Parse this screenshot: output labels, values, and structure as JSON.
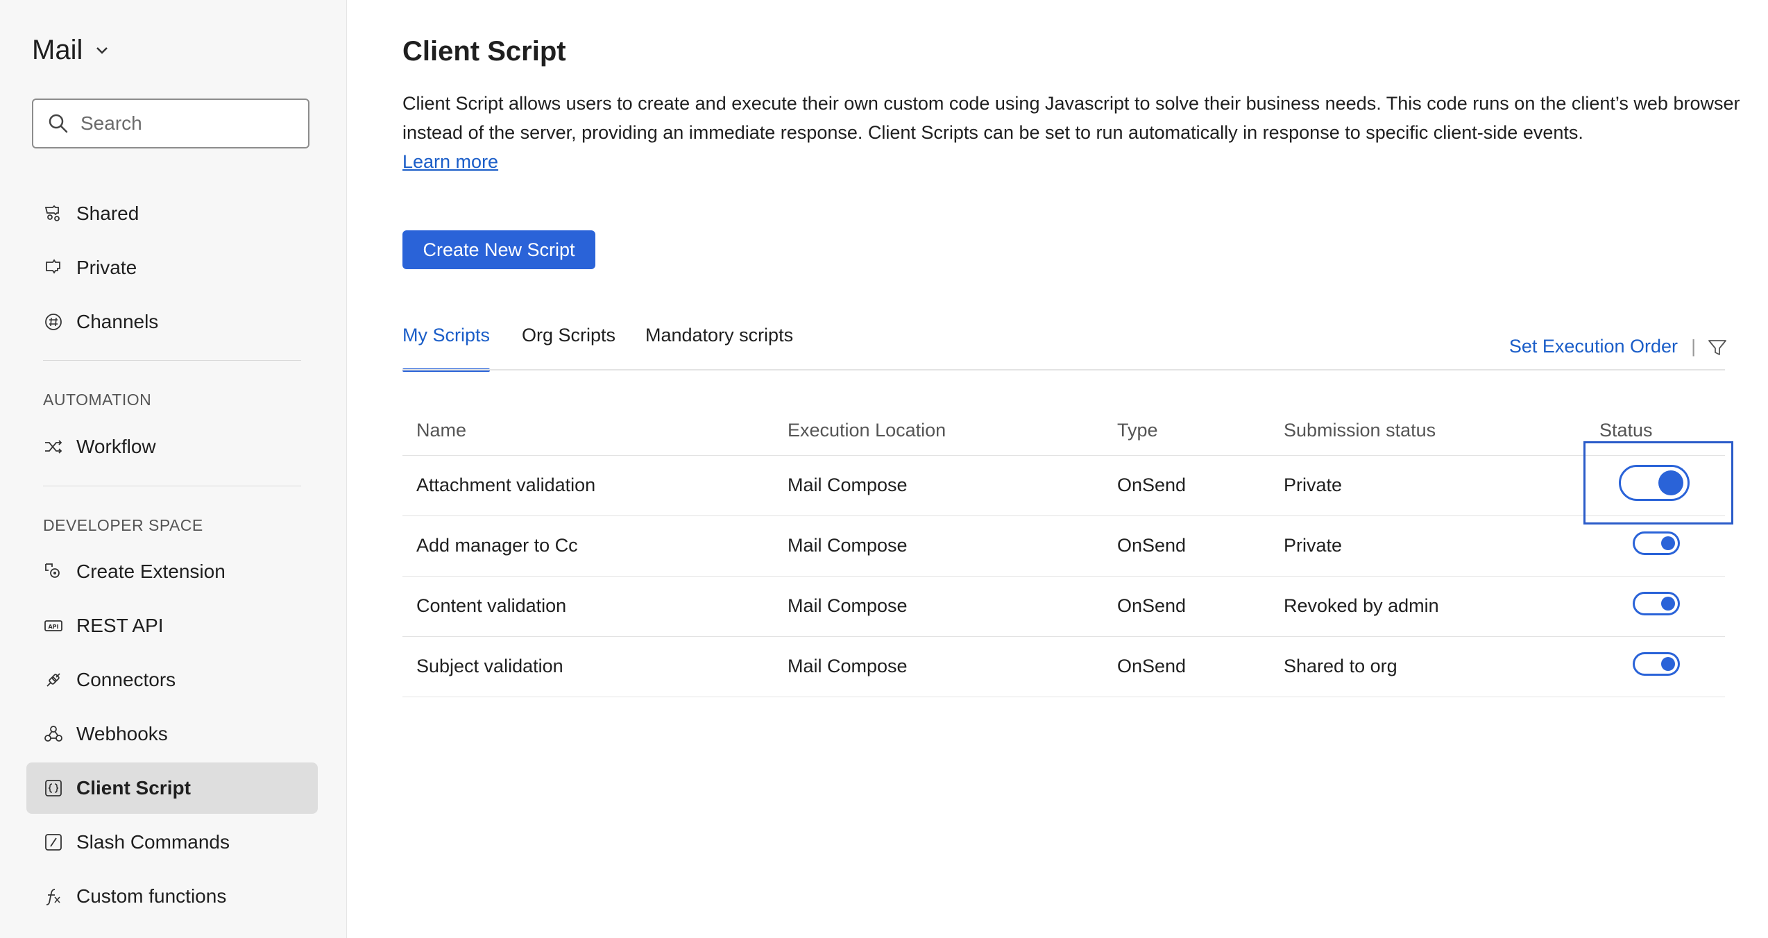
{
  "sidebar": {
    "app_name": "Mail",
    "search_placeholder": "Search",
    "nav_top": [
      {
        "label": "Shared"
      },
      {
        "label": "Private"
      },
      {
        "label": "Channels"
      }
    ],
    "automation_label": "AUTOMATION",
    "automation_items": [
      {
        "label": "Workflow"
      }
    ],
    "developer_label": "DEVELOPER SPACE",
    "developer_items": [
      {
        "label": "Create Extension"
      },
      {
        "label": "REST API"
      },
      {
        "label": "Connectors"
      },
      {
        "label": "Webhooks"
      },
      {
        "label": "Client Script",
        "active": true
      },
      {
        "label": "Slash Commands"
      },
      {
        "label": "Custom functions"
      }
    ]
  },
  "main": {
    "title": "Client Script",
    "description": "Client Script allows users to create and execute their own custom code using Javascript to solve their business needs. This code runs on the client’s web browser instead of the server, providing an immediate response. Client Scripts can be set to run automatically in response to specific client-side events.",
    "learn_more": "Learn more",
    "create_button": "Create New Script",
    "tabs": [
      {
        "label": "My Scripts",
        "active": true
      },
      {
        "label": "Org Scripts"
      },
      {
        "label": "Mandatory scripts"
      }
    ],
    "set_execution_order": "Set Execution Order",
    "separator": "|",
    "table": {
      "headers": [
        "Name",
        "Execution Location",
        "Type",
        "Submission status",
        "Status"
      ],
      "rows": [
        {
          "name": "Attachment validation",
          "location": "Mail Compose",
          "type": "OnSend",
          "submission": "Private",
          "enabled": true
        },
        {
          "name": "Add manager to Cc",
          "location": "Mail Compose",
          "type": "OnSend",
          "submission": "Private",
          "enabled": true
        },
        {
          "name": "Content validation",
          "location": "Mail Compose",
          "type": "OnSend",
          "submission": "Revoked by admin",
          "enabled": true
        },
        {
          "name": "Subject validation",
          "location": "Mail Compose",
          "type": "OnSend",
          "submission": "Shared to org",
          "enabled": true
        }
      ]
    }
  },
  "colors": {
    "accent": "#2a63d8",
    "link": "#1a5dc8",
    "sidebar_bg": "#f7f7f7",
    "active_nav_bg": "#dedede"
  }
}
